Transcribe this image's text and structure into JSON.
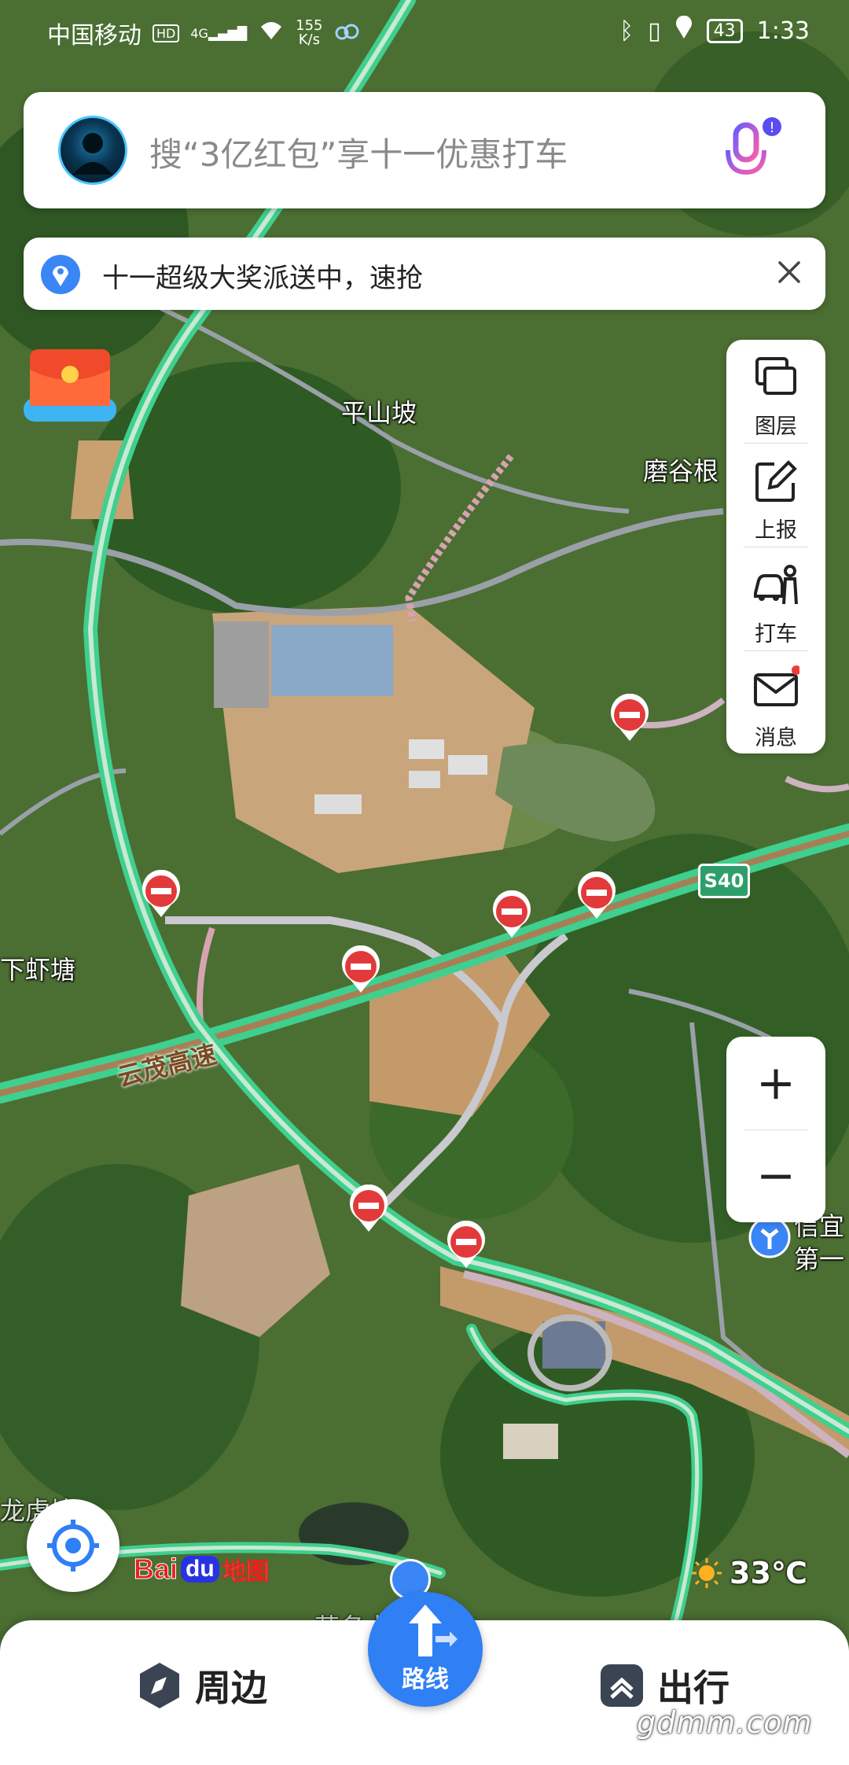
{
  "status_bar": {
    "carrier": "中国移动",
    "hd": "HD",
    "signal_label": "4G",
    "speed_value": "155",
    "speed_unit": "K/s",
    "battery": "43",
    "time": "1:33"
  },
  "search": {
    "placeholder": "搜“3亿红包”享十一优惠打车"
  },
  "notice": {
    "text": "十一超级大奖派送中，速抢"
  },
  "toolbar": {
    "items": [
      {
        "label": "图层",
        "icon": "layers-icon"
      },
      {
        "label": "上报",
        "icon": "report-icon"
      },
      {
        "label": "打车",
        "icon": "taxi-icon"
      },
      {
        "label": "消息",
        "icon": "message-icon"
      }
    ]
  },
  "zoom": {
    "in": "+",
    "out": "−"
  },
  "map_labels": {
    "pingshanpo": "平山坡",
    "tanggugen": "磨谷根",
    "xiaxiatang": "下虾塘",
    "highway": "云茂高速",
    "road_badge": "S40",
    "poi": "信宜",
    "poi2": "第一",
    "bottom_left": "龙虎塘",
    "bottom_road": "茂名大道路"
  },
  "logo": {
    "bai": "Bai",
    "du": "du",
    "ditu": "地图"
  },
  "weather": {
    "temperature": "33℃"
  },
  "bottom_nav": {
    "nearby": "周边",
    "route": "路线",
    "travel": "出行"
  },
  "watermark": "gdmm.com",
  "colors": {
    "accent": "#2f7ff5",
    "highway": "#3fcf8e",
    "closure": "#e23a3a"
  }
}
